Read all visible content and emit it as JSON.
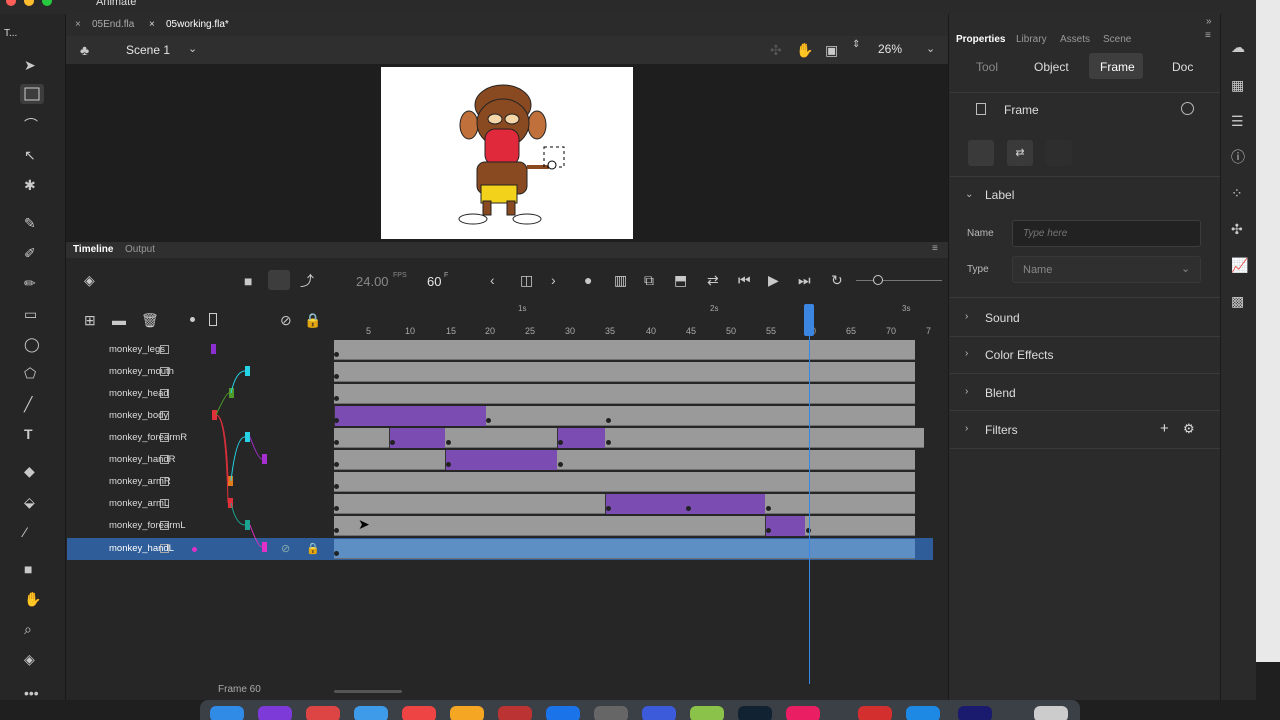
{
  "app": {
    "title": "Animate"
  },
  "tools_label": "T...",
  "tabs": [
    {
      "label": "05End.fla"
    },
    {
      "label": "05working.fla*"
    }
  ],
  "scene": {
    "name": "Scene 1",
    "zoom": "26%"
  },
  "timeline": {
    "tabs": [
      "Timeline",
      "Output"
    ],
    "fps": "24.00",
    "fps_unit": "FPS",
    "frame": "60",
    "frame_unit": "F",
    "seconds": [
      "1s",
      "2s",
      "3s"
    ],
    "ruler": [
      "5",
      "10",
      "15",
      "20",
      "25",
      "30",
      "35",
      "40",
      "45",
      "50",
      "55",
      "60",
      "65",
      "70",
      "7"
    ],
    "current_frame_label": "Frame 60",
    "layers": [
      {
        "name": "monkey_legs",
        "color": "#8b2fd0"
      },
      {
        "name": "monkey_mouth",
        "color": "#25d4e6"
      },
      {
        "name": "monkey_head",
        "color": "#4f9a2a"
      },
      {
        "name": "monkey_body",
        "color": "#e0303a"
      },
      {
        "name": "monkey_forearmR",
        "color": "#25d4e6"
      },
      {
        "name": "monkey_handR",
        "color": "#a62fd0"
      },
      {
        "name": "monkey_armR",
        "color": "#e07a1a"
      },
      {
        "name": "monkey_armL",
        "color": "#e0303a"
      },
      {
        "name": "monkey_forearmL",
        "color": "#1aa38f"
      },
      {
        "name": "monkey_handL",
        "color": "#e030c8",
        "selected": true
      }
    ]
  },
  "properties": {
    "tabs": [
      "Properties",
      "Library",
      "Assets",
      "Scene"
    ],
    "subtabs": [
      "Tool",
      "Object",
      "Frame",
      "Doc"
    ],
    "frame_title": "Frame",
    "label_section": "Label",
    "name_label": "Name",
    "name_placeholder": "Type here",
    "type_label": "Type",
    "type_value": "Name",
    "sections": [
      "Sound",
      "Color Effects",
      "Blend",
      "Filters"
    ]
  }
}
